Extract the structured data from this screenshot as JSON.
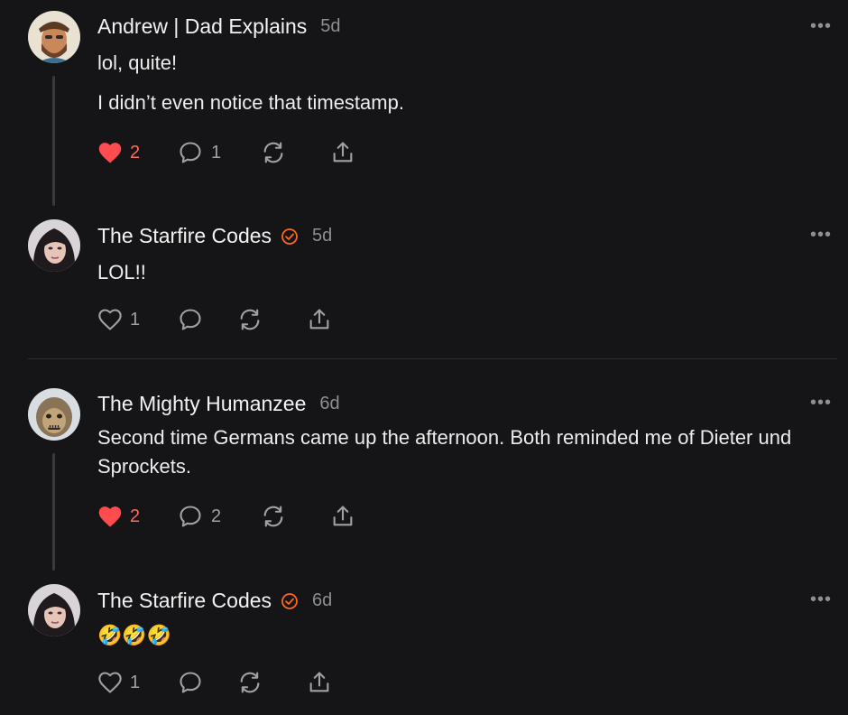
{
  "comments": [
    {
      "author": "Andrew | Dad Explains",
      "time": "5d",
      "verified": false,
      "paragraphs": [
        "lol, quite!",
        "I didn’t even notice that timestamp."
      ],
      "likes": "2",
      "liked": true,
      "replies": "1",
      "more": "•••"
    },
    {
      "author": "The Starfire Codes",
      "time": "5d",
      "verified": true,
      "paragraphs": [
        "LOL!!"
      ],
      "likes": "1",
      "liked": false,
      "replies": "",
      "more": "•••"
    },
    {
      "author": "The Mighty Humanzee",
      "time": "6d",
      "verified": false,
      "paragraphs": [
        "Second time Germans came up the afternoon. Both reminded me of Dieter und Sprockets."
      ],
      "likes": "2",
      "liked": true,
      "replies": "2",
      "more": "•••"
    },
    {
      "author": "The Starfire Codes",
      "time": "6d",
      "verified": true,
      "paragraphs": [
        "🤣🤣🤣"
      ],
      "likes": "1",
      "liked": false,
      "replies": "",
      "more": "•••"
    }
  ],
  "colors": {
    "background": "#151517",
    "like_active": "#ff4d4f",
    "verified_badge": "#ff6719"
  }
}
